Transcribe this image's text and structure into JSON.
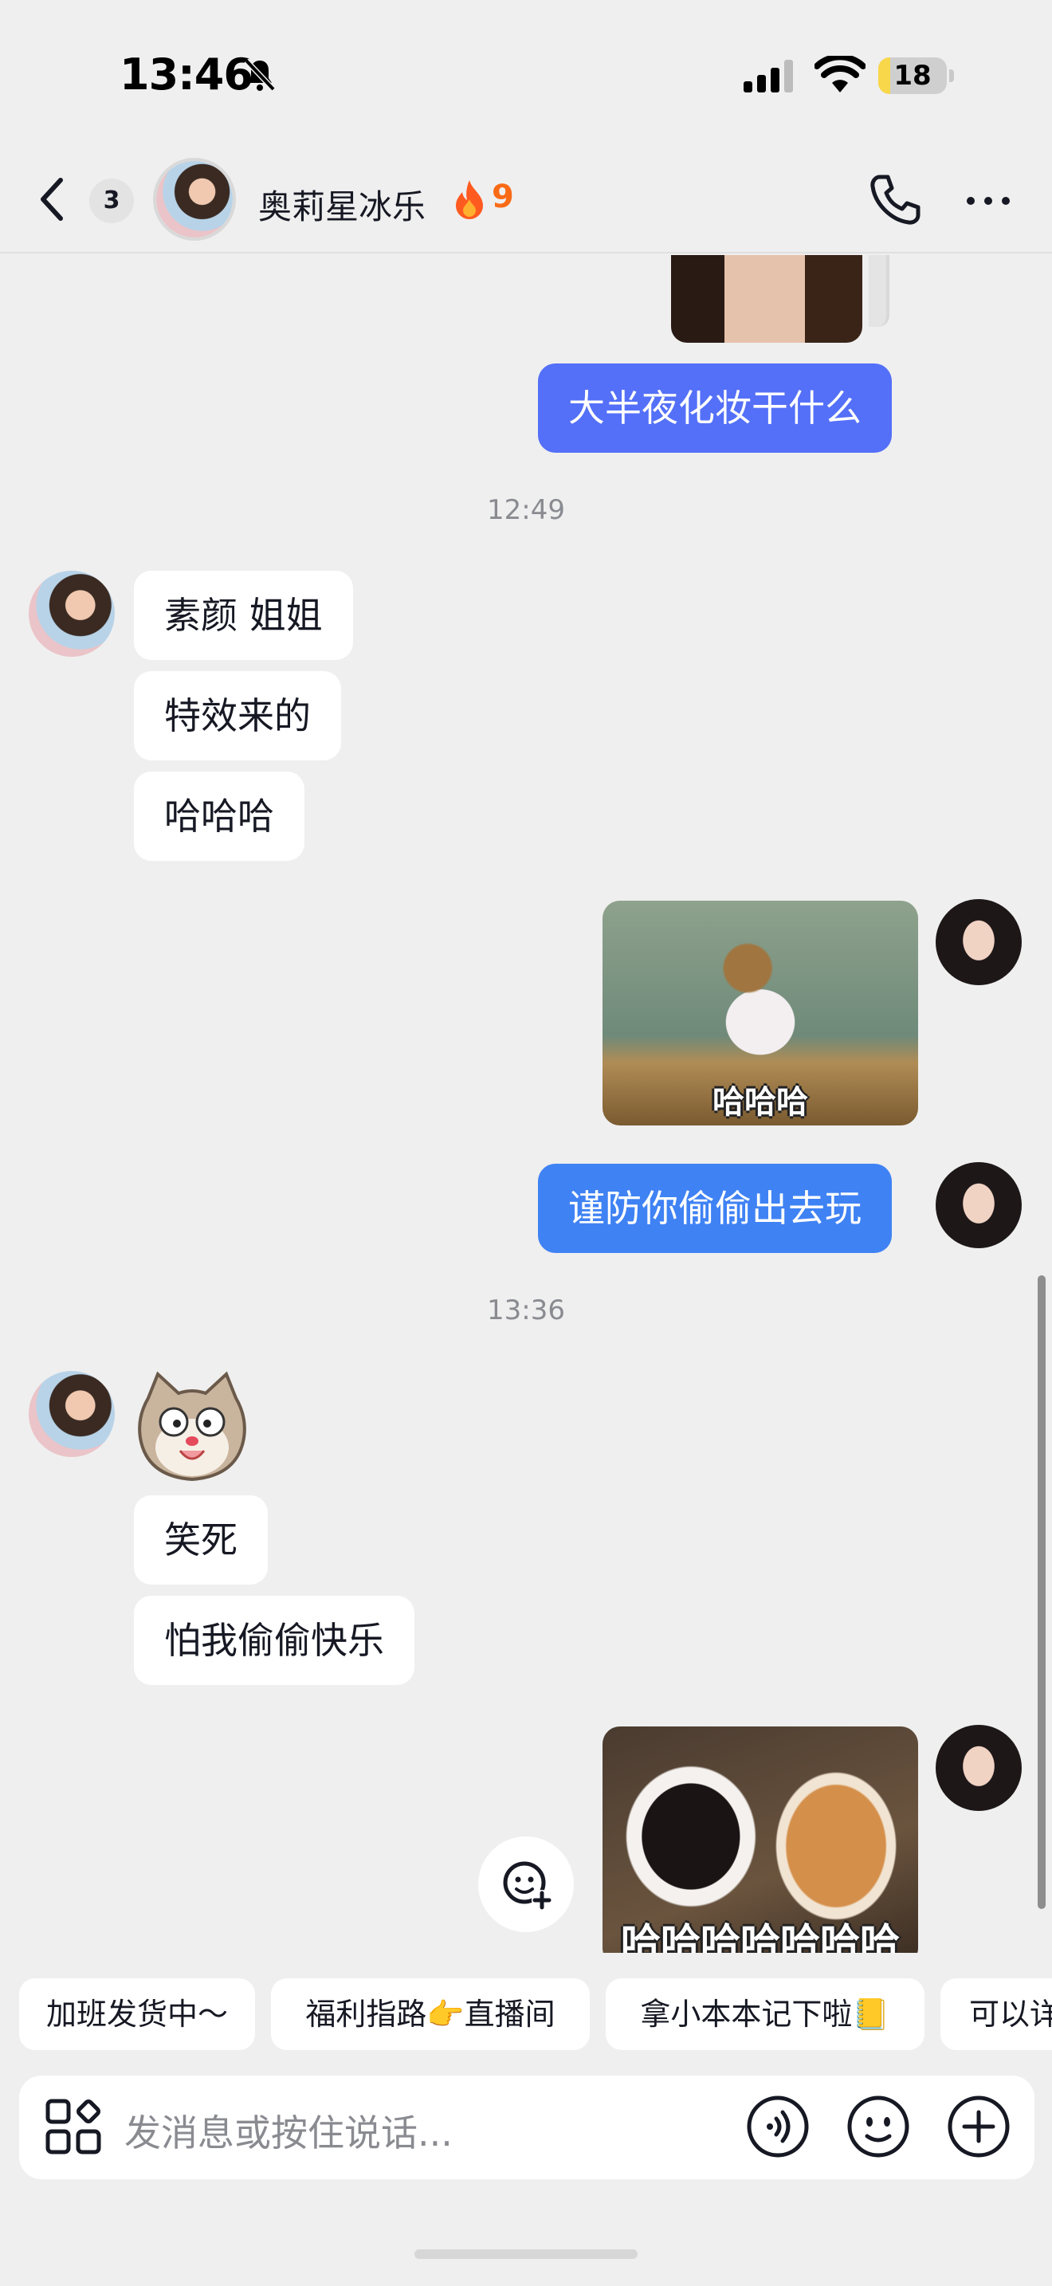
{
  "status_bar": {
    "time": "13:46",
    "battery_level": "18",
    "battery_fraction": 0.18,
    "icons": [
      "bell-slash-icon",
      "cellular-signal-icon",
      "wifi-icon",
      "battery-icon"
    ]
  },
  "header": {
    "unread_count": "3",
    "contact_name": "奥莉星冰乐",
    "streak_count": "9",
    "icons": [
      "back-icon",
      "fire-icon",
      "phone-icon",
      "more-icon"
    ]
  },
  "messages": {
    "m1_text": "大半夜化妆干什么",
    "t1": "12:49",
    "m2_text": "素颜 姐姐",
    "m3_text": "特效来的",
    "m4_text": "哈哈哈",
    "m5_image_caption": "哈哈哈",
    "m6_text": "谨防你偷偷出去玩",
    "t2": "13:36",
    "m7_sticker": "cat-face-sticker",
    "m8_text": "笑死",
    "m9_text": "怕我偷偷快乐",
    "m10_image_caption": "哈哈哈哈哈哈哈"
  },
  "quick_replies": [
    "加班发货中～",
    "福利指路👉直播间",
    "拿小本本记下啦📒",
    "可以详"
  ],
  "input_bar": {
    "placeholder": "发消息或按住说话...",
    "icons": [
      "apps-icon",
      "voice-icon",
      "emoji-icon",
      "plus-icon"
    ]
  },
  "colors": {
    "background": "#efefef",
    "outgoing_bubble": "#5470f8",
    "outgoing_bubble_alt": "#3f82f4",
    "streak": "#f96a16",
    "battery": "#f8d74a"
  }
}
